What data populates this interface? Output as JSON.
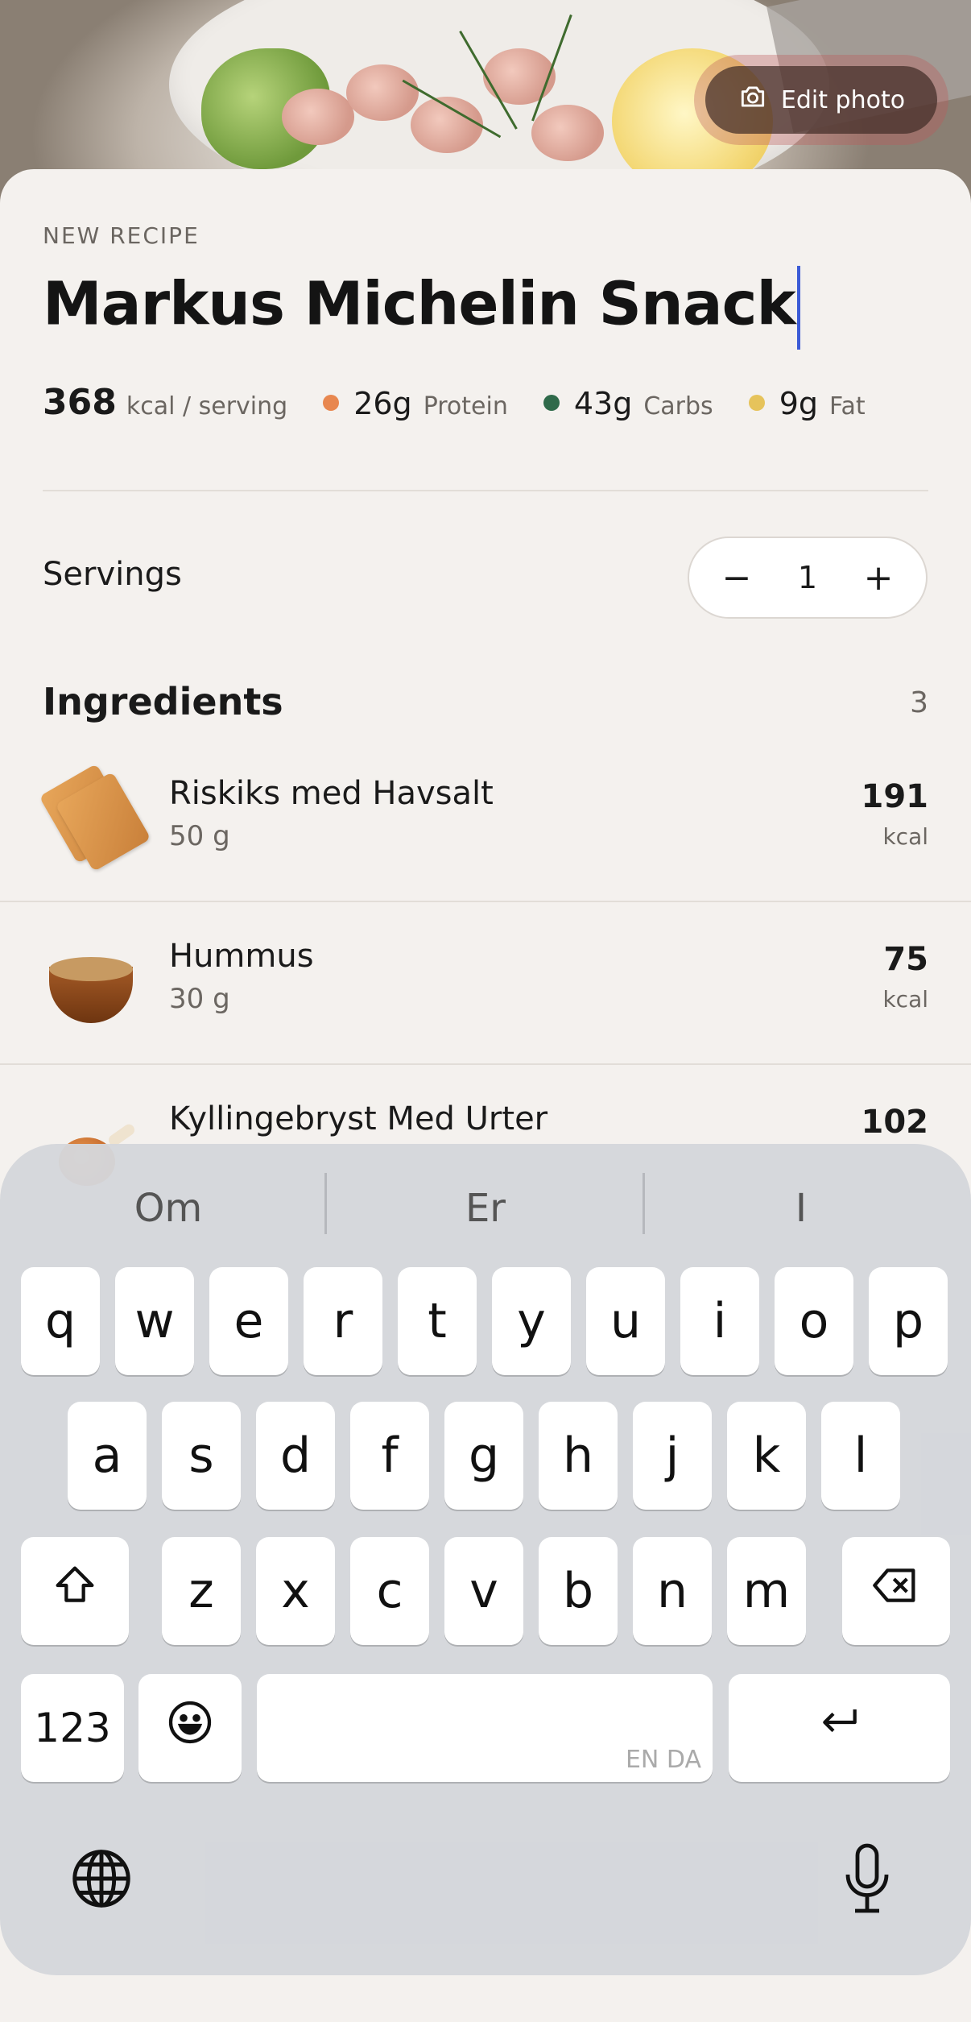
{
  "hero": {
    "edit_photo_label": "Edit photo"
  },
  "recipe": {
    "eyebrow": "NEW RECIPE",
    "title": "Markus Michelin Snack",
    "kcal": "368",
    "kcal_unit": "kcal / serving",
    "macros": [
      {
        "value": "26g",
        "label": "Protein",
        "color": "#e8874f"
      },
      {
        "value": "43g",
        "label": "Carbs",
        "color": "#2f6a4a"
      },
      {
        "value": "9g",
        "label": "Fat",
        "color": "#e6c35b"
      }
    ]
  },
  "servings": {
    "label": "Servings",
    "value": "1",
    "minus": "−",
    "plus": "+"
  },
  "ingredients": {
    "heading": "Ingredients",
    "count": "3",
    "items": [
      {
        "name": "Riskiks med Havsalt",
        "qty": "50 g",
        "kcal": "191",
        "unit": "kcal",
        "icon": "cracker-icon"
      },
      {
        "name": "Hummus",
        "qty": "30 g",
        "kcal": "75",
        "unit": "kcal",
        "icon": "hummus-icon"
      },
      {
        "name": "Kyllingebryst Med Urter",
        "qty": "",
        "kcal": "102",
        "unit": "",
        "icon": "chicken-leg-icon"
      }
    ]
  },
  "keyboard": {
    "suggestions": [
      "Om",
      "Er",
      "I"
    ],
    "row1": [
      "q",
      "w",
      "e",
      "r",
      "t",
      "y",
      "u",
      "i",
      "o",
      "p"
    ],
    "row2": [
      "a",
      "s",
      "d",
      "f",
      "g",
      "h",
      "j",
      "k",
      "l"
    ],
    "row3": [
      "z",
      "x",
      "c",
      "v",
      "b",
      "n",
      "m"
    ],
    "numbers_key": "123",
    "space_lang": "EN DA",
    "icons": {
      "shift": "shift-icon",
      "backspace": "backspace-icon",
      "emoji": "emoji-icon",
      "return": "return-icon",
      "globe": "globe-icon",
      "mic": "microphone-icon"
    }
  }
}
